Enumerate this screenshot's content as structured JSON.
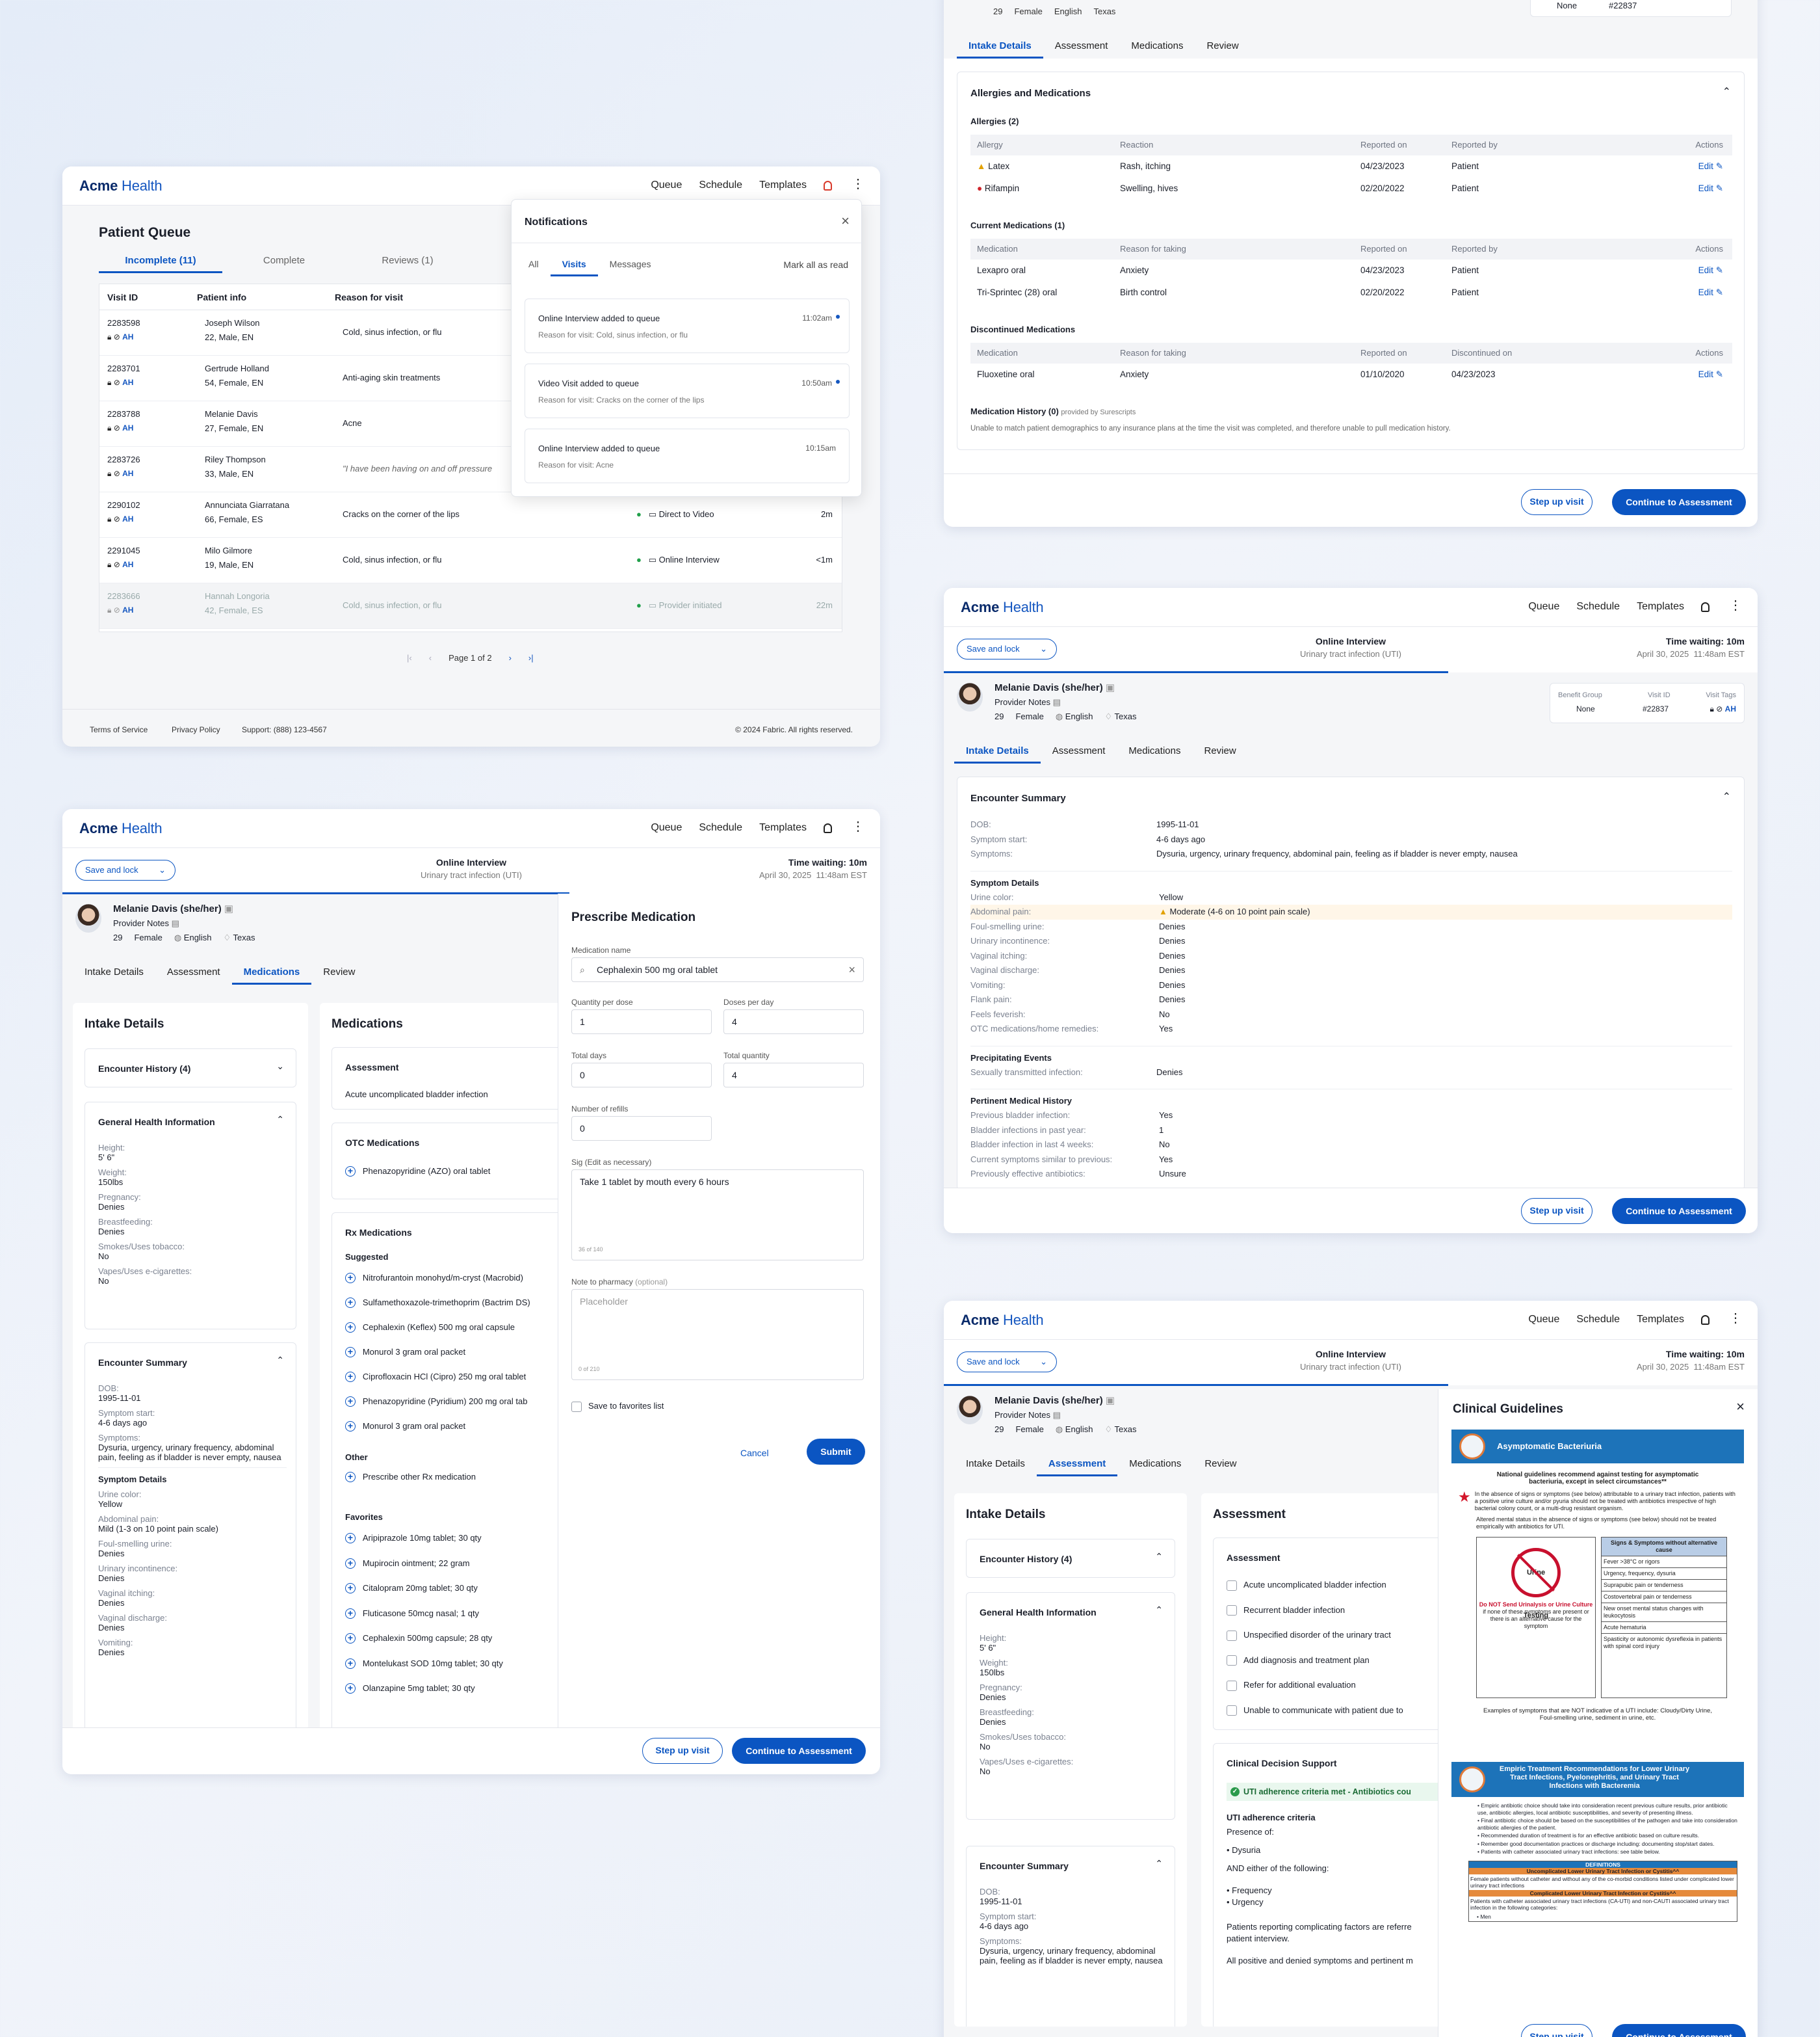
{
  "brand": {
    "name_bold": "Acme",
    "name_rest": " Health"
  },
  "nav": {
    "queue": "Queue",
    "schedule": "Schedule",
    "templates": "Templates"
  },
  "queue": {
    "title": "Patient Queue",
    "tabs": [
      "Incomplete (11)",
      "Complete",
      "Reviews (1)"
    ],
    "headers": [
      "Visit ID",
      "Patient info",
      "Reason for visit"
    ],
    "rows": [
      {
        "id": "2283598",
        "name": "Joseph Wilson",
        "meta": "22, Male, EN",
        "reason": "Cold, sinus infection, or flu",
        "type": "",
        "time": ""
      },
      {
        "id": "2283701",
        "name": "Gertrude Holland",
        "meta": "54, Female, EN",
        "reason": "Anti-aging skin treatments",
        "type": "",
        "time": ""
      },
      {
        "id": "2283788",
        "name": "Melanie Davis",
        "meta": "27, Female, EN",
        "reason": "Acne",
        "type": "",
        "time": ""
      },
      {
        "id": "2283726",
        "name": "Riley Thompson",
        "meta": "33, Male, EN",
        "reason": "\"I have been having on and off pressure",
        "type": "",
        "time": ""
      },
      {
        "id": "2290102",
        "name": "Annunciata Giarratana",
        "meta": "66, Female, ES",
        "reason": "Cracks on the corner of the lips",
        "type": "Direct to Video",
        "time": "2m"
      },
      {
        "id": "2291045",
        "name": "Milo Gilmore",
        "meta": "19, Male, EN",
        "reason": "Cold, sinus infection, or flu",
        "type": "Online Interview",
        "time": "<1m"
      },
      {
        "id": "2283666",
        "name": "Hannah Longoria",
        "meta": "42, Female, ES",
        "reason": "Cold, sinus infection, or flu",
        "type": "Provider initiated",
        "time": "22m"
      }
    ],
    "pagination": "Page 1 of 2",
    "footer": {
      "tos": "Terms of Service",
      "privacy": "Privacy Policy",
      "support": "Support: (888) 123-4567",
      "copy": "© 2024 Fabric. All rights reserved."
    }
  },
  "notifications": {
    "title": "Notifications",
    "tabs": [
      "All",
      "Visits",
      "Messages"
    ],
    "mark": "Mark all as read",
    "items": [
      {
        "title": "Online Interview added to queue",
        "time": "11:02am",
        "sub": "Reason for visit: Cold, sinus infection, or flu"
      },
      {
        "title": "Video Visit added to queue",
        "time": "10:50am",
        "sub": "Reason for visit: Cracks on the corner of the lips"
      },
      {
        "title": "Online Interview added to queue",
        "time": "10:15am",
        "sub": "Reason for visit: Acne"
      }
    ]
  },
  "visit": {
    "save_lock": "Save and lock",
    "visit_type": "Online Interview",
    "visit_reason": "Urinary tract infection (UTI)",
    "time_waiting": "Time waiting: 10m",
    "date": "April 30, 2025",
    "date_time": "11:48am EST",
    "patient_name": "Melanie Davis (she/her)",
    "provider_notes": "Provider Notes",
    "age": "29",
    "sex": "Female",
    "lang": "English",
    "state": "Texas",
    "benefit_label": "Benefit Group",
    "benefit": "None",
    "visitid_label": "Visit ID",
    "visitid": "#22837",
    "tags_label": "Visit Tags",
    "tabs": [
      "Intake Details",
      "Assessment",
      "Medications",
      "Review"
    ],
    "step_up": "Step up visit",
    "continue": "Continue to Assessment"
  },
  "allergies": {
    "section": "Allergies and Medications",
    "allergies_title": "Allergies (2)",
    "allergy_headers": [
      "Allergy",
      "Reaction",
      "Reported on",
      "Reported by",
      "Actions"
    ],
    "allergy_rows": [
      [
        "Latex",
        "Rash, itching",
        "04/23/2023",
        "Patient",
        "Edit"
      ],
      [
        "Rifampin",
        "Swelling, hives",
        "02/20/2022",
        "Patient",
        "Edit"
      ]
    ],
    "current_title": "Current Medications (1)",
    "current_headers": [
      "Medication",
      "Reason for taking",
      "Reported on",
      "Reported by",
      "Actions"
    ],
    "current_rows": [
      [
        "Lexapro oral",
        "Anxiety",
        "04/23/2023",
        "Patient",
        "Edit"
      ],
      [
        "Tri-Sprintec (28) oral",
        "Birth control",
        "02/20/2022",
        "Patient",
        "Edit"
      ]
    ],
    "disc_title": "Discontinued Medications",
    "disc_headers": [
      "Medication",
      "Reason for taking",
      "Reported on",
      "Discontinued on",
      "Actions"
    ],
    "disc_rows": [
      [
        "Fluoxetine oral",
        "Anxiety",
        "01/10/2020",
        "04/23/2023",
        "Edit"
      ]
    ],
    "history_title": "Medication History (0)",
    "history_provided": "provided by Surescripts",
    "history_msg": "Unable to match patient demographics to any insurance plans at the time the visit was completed, and therefore unable to pull medication history."
  },
  "encounter": {
    "title": "Encounter Summary",
    "dob_l": "DOB:",
    "dob": "1995-11-01",
    "start_l": "Symptom start:",
    "start": "4-6 days ago",
    "sym_l": "Symptoms:",
    "sym": "Dysuria, urgency, urinary frequency, abdominal pain, feeling as if bladder is never empty, nausea",
    "details_title": "Symptom Details",
    "details": [
      [
        "Urine color:",
        "Yellow"
      ],
      [
        "Abdominal pain:",
        "Moderate (4-6 on 10 point pain scale)"
      ],
      [
        "Foul-smelling urine:",
        "Denies"
      ],
      [
        "Urinary incontinence:",
        "Denies"
      ],
      [
        "Vaginal itching:",
        "Denies"
      ],
      [
        "Vaginal discharge:",
        "Denies"
      ],
      [
        "Vomiting:",
        "Denies"
      ],
      [
        "Flank pain:",
        "Denies"
      ],
      [
        "Feels feverish:",
        "No"
      ],
      [
        "OTC medications/home remedies:",
        "Yes"
      ]
    ],
    "precip_title": "Precipitating Events",
    "precip": [
      [
        "Sexually transmitted infection:",
        "Denies"
      ]
    ],
    "pmh_title": "Pertinent Medical History",
    "pmh": [
      [
        "Previous bladder infection:",
        "Yes"
      ],
      [
        "Bladder infections in past year:",
        "1"
      ],
      [
        "Bladder infection in last 4 weeks:",
        "No"
      ],
      [
        "Current symptoms similar to previous:",
        "Yes"
      ],
      [
        "Previously effective antibiotics:",
        "Unsure"
      ]
    ]
  },
  "meds": {
    "intake_title": "Intake Details",
    "encounter_history": "Encounter History (4)",
    "ghi_title": "General Health Information",
    "ghi": [
      [
        "Height:",
        "5' 6\""
      ],
      [
        "Weight:",
        "150lbs"
      ],
      [
        "Pregnancy:",
        "Denies"
      ],
      [
        "Breastfeeding:",
        "Denies"
      ],
      [
        "Smokes/Uses tobacco:",
        "No"
      ],
      [
        "Vapes/Uses e-cigarettes:",
        "No"
      ]
    ],
    "enc_title": "Encounter Summary",
    "enc": [
      [
        "DOB:",
        "1995-11-01"
      ],
      [
        "Symptom start:",
        "4-6 days ago"
      ],
      [
        "Symptoms:",
        "Dysuria, urgency, urinary frequency, abdominal pain, feeling as if bladder is never empty, nausea"
      ]
    ],
    "sd_title": "Symptom Details",
    "sd": [
      [
        "Urine color:",
        "Yellow"
      ],
      [
        "Abdominal pain:",
        "Mild (1-3 on 10 point pain scale)"
      ],
      [
        "Foul-smelling urine:",
        "Denies"
      ],
      [
        "Urinary incontinence:",
        "Denies"
      ],
      [
        "Vaginal itching:",
        "Denies"
      ],
      [
        "Vaginal discharge:",
        "Denies"
      ],
      [
        "Vomiting:",
        "Denies"
      ]
    ],
    "med_title": "Medications",
    "assessment_title": "Assessment",
    "assessment_item": "Acute uncomplicated bladder infection",
    "otc_title": "OTC Medications",
    "otc": [
      "Phenazopyridine (AZO) oral tablet"
    ],
    "rx_title": "Rx Medications",
    "suggested": "Suggested",
    "rx": [
      "Nitrofurantoin monohyd/m-cryst (Macrobid)",
      "Sulfamethoxazole-trimethoprim (Bactrim DS)",
      "Cephalexin (Keflex) 500 mg oral capsule",
      "Monurol 3 gram oral packet",
      "Ciprofloxacin HCl (Cipro) 250 mg oral tablet",
      "Phenazopyridine (Pyridium) 200 mg oral tab",
      "Monurol 3 gram oral packet"
    ],
    "other": "Other",
    "other_item": "Prescribe other Rx medication",
    "fav": "Favorites",
    "favs": [
      "Aripiprazole 10mg tablet; 30 qty",
      "Mupirocin ointment; 22 gram",
      "Citalopram 20mg tablet; 30 qty",
      "Fluticasone 50mcg nasal; 1 qty",
      "Cephalexin 500mg capsule; 28 qty",
      "Montelukast SOD 10mg tablet; 30 qty",
      "Olanzapine 5mg tablet; 30 qty"
    ]
  },
  "prescribe": {
    "title": "Prescribe Medication",
    "name_l": "Medication name",
    "name": "Cephalexin 500 mg oral tablet",
    "qty_l": "Quantity per dose",
    "qty": "1",
    "dpd_l": "Doses per day",
    "dpd": "4",
    "days_l": "Total days",
    "days": "0",
    "tq_l": "Total quantity",
    "tq": "4",
    "ref_l": "Number of refills",
    "ref": "0",
    "sig_l": "Sig (Edit as necessary)",
    "sig": "Take 1 tablet by mouth every 6 hours",
    "sig_count": "36 of 140",
    "note_l": "Note to pharmacy",
    "note_opt": "(optional)",
    "note_ph": "Placeholder",
    "note_count": "0 of 210",
    "fav": "Save to favorites list",
    "cancel": "Cancel",
    "submit": "Submit"
  },
  "assess": {
    "intake_title": "Intake Details",
    "title": "Assessment",
    "box_title": "Assessment",
    "items": [
      "Acute uncomplicated bladder infection",
      "Recurrent bladder infection",
      "Unspecified disorder of the urinary tract",
      "Add diagnosis and treatment plan",
      "Refer for additional evaluation",
      "Unable to communicate with patient due to"
    ],
    "cds_title": "Clinical Decision Support",
    "cds_badge": "UTI adherence criteria met - Antibiotics cou",
    "uti_title": "UTI adherence criteria",
    "presence": "Presence of:",
    "p1": "Dysuria",
    "and": "AND either of the following:",
    "a1": "Frequency",
    "a2": "Urgency",
    "comp": "Patients reporting complicating factors are referre",
    "comp2": "patient interview.",
    "all": "All positive and denied symptoms and pertinent m",
    "enc_title": "Encounter Summary",
    "enc": [
      [
        "DOB:",
        "1995-11-01"
      ],
      [
        "Symptom start:",
        "4-6 days ago"
      ],
      [
        "Symptoms:",
        "Dysuria, urgency, urinary frequency, abdominal pain, feeling as if bladder is never empty, nausea"
      ]
    ]
  },
  "guidelines": {
    "title": "Clinical Guidelines",
    "banner1": "Asymptomatic Bacteriuria",
    "h1": "National guidelines recommend against testing for asymptomatic bacteriuria, except in select circumstances**",
    "p1": "In the absence of signs or symptoms (see below) attributable to a urinary tract infection, patients with a positive urine culture and/or pyuria should not be treated with antibiotics irrespective of high bacterial colony count, or a multi-drug resistant organism.",
    "p2": "Altered mental status in the absence of signs or symptoms (see below) should not be treated empirically with antibiotics for UTI.",
    "no_test": "Urine Testing",
    "dont": "Do NOT Send Urinalysis or Urine Culture",
    "dont2": "if none of these symptoms are present or there is an alternative cause for the symptom",
    "sx_head": "Signs & Symptoms without alternative cause",
    "sx": [
      "Fever >38°C or rigors",
      "Urgency, frequency, dysuria",
      "Suprapubic pain or tenderness",
      "Costovertebral pain or tenderness",
      "New onset mental status changes with leukocytosis",
      "Acute hematuria",
      "Spasticity or autonomic dysreflexia in patients with spinal cord injury"
    ],
    "examples": "Examples of symptoms that are NOT indicative of a UTI include: Cloudy/Dirty Urine, Foul-smelling urine, sediment in urine, etc.",
    "banner2": "Empiric Treatment Recommendations for Lower Urinary Tract Infections, Pyelonephritis, and Urinary Tract Infections with Bacteremia",
    "b_items": [
      "Empiric antibiotic choice should take into consideration recent previous culture results, prior antibiotic use, antibiotic allergies, local antibiotic susceptibilities, and severity of presenting illness.",
      "Final antibiotic choice should be based on the susceptibilities of the pathogen and take into consideration antibiotic allergies of the patient.",
      "Recommended duration of treatment is for an effective antibiotic based on culture results.",
      "Remember good documentation practices or discharge including: documenting stop/start dates.",
      "Patients with catheter associated urinary tract infections: see table below."
    ],
    "defs": "DEFINITIONS",
    "d1": "Uncomplicated Lower Urinary Tract Infection or Cystitis^^",
    "d1t": "Female patients without catheter and without any of the co-morbid conditions listed under complicated lower urinary tract infections",
    "d2": "Complicated Lower Urinary Tract Infection or Cystitis^^",
    "d2t": "Patients with catheter associated urinary tract infections (CA-UTI) and non-CAUTI associated urinary tract infection in the following categories:",
    "d2b": "Men"
  }
}
